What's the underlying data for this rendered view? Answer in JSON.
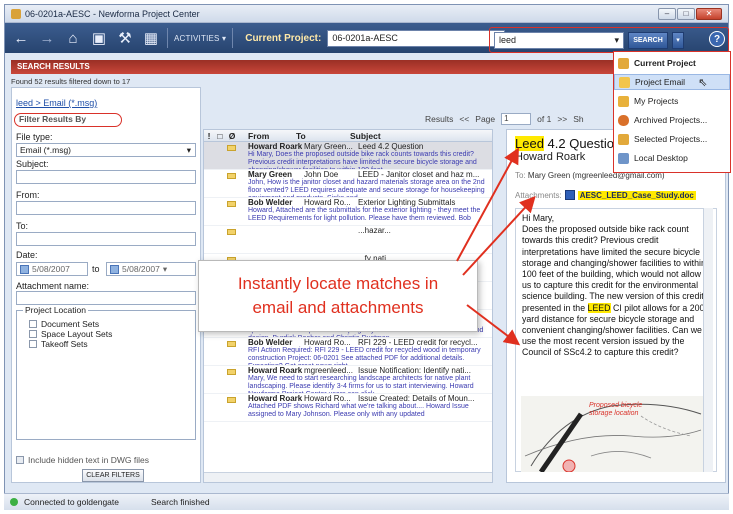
{
  "window": {
    "title": "06-0201a-AESC - Newforma Project Center"
  },
  "toolbar": {
    "activities_label": "ACTIVITIES",
    "current_project_label": "Current Project:",
    "current_project_value": "06-0201a-AESC",
    "search_value": "leed",
    "search_button": "SEARCH"
  },
  "search_scope_menu": {
    "items": [
      {
        "label": "Current Project",
        "icon": "project-icon"
      },
      {
        "label": "Project Email",
        "icon": "email-icon"
      },
      {
        "label": "My Projects",
        "icon": "my-projects-icon"
      },
      {
        "label": "Archived Projects...",
        "icon": "archive-icon"
      },
      {
        "label": "Selected Projects...",
        "icon": "selected-projects-icon"
      },
      {
        "label": "Local Desktop",
        "icon": "desktop-icon"
      }
    ]
  },
  "results": {
    "header": "SEARCH RESULTS",
    "found_text": "Found 52 results filtered down to 17",
    "breadcrumb": "leed > Email (*.msg)",
    "filter_heading": "Filter Results By",
    "pager": {
      "results_label": "Results",
      "prev": "<<",
      "page_label": "Page",
      "page_value": "1",
      "of_label": "of 1",
      "next": ">>",
      "show_label": "Sh"
    }
  },
  "filters": {
    "file_type_label": "File type:",
    "file_type_value": "Email (*.msg)",
    "subject_label": "Subject:",
    "from_label": "From:",
    "to_label": "To:",
    "date_label": "Date:",
    "date_from": "5/08/2007",
    "date_to_label": "to",
    "date_to": "5/08/2007",
    "attachment_label": "Attachment name:",
    "project_location_label": "Project Location",
    "locations": [
      "Document Sets",
      "Space Layout Sets",
      "Takeoff Sets"
    ],
    "include_hidden_label": "Include hidden text in DWG files",
    "clear_button": "CLEAR FILTERS"
  },
  "list": {
    "columns": [
      "!",
      "□",
      "Ø",
      "From",
      "To",
      "Subject"
    ],
    "rows": [
      {
        "from": "Howard Roark",
        "to": "Mary Green...",
        "subject": "Leed 4.2 Question",
        "preview": "Hi Mary,  Does the proposed outside bike rack counts towards this credit? Previous credit interpretations have limited the secure bicycle storage and changing/shower facilities to within 100 feet",
        "selected": true
      },
      {
        "from": "Mary Green",
        "to": "John Doe",
        "subject": "LEED - Janitor closet and haz m...",
        "preview": "John,  How is the janitor closet and hazard materials storage area on the 2nd floor vented? LEED requires adequate and secure storage for housekeeping equipment and products.  Sinks and",
        "selected": false
      },
      {
        "from": "Bob Welder",
        "to": "Howard Ro...",
        "subject": "Exterior Lighting Submittals",
        "preview": "Howard,  Attached are the submittals for the exterior lighting - they meet the LEED Requirements for light pollution.  Please have them reviewed.  Bob",
        "selected": false
      },
      {
        "from": "",
        "to": "",
        "subject": "...hazar...",
        "preview": "",
        "selected": false
      },
      {
        "from": "",
        "to": "",
        "subject": "...fy nati...",
        "preview": "",
        "selected": false
      },
      {
        "from": "",
        "to": "",
        "subject": "",
        "preview": "",
        "selected": false
      },
      {
        "from": "Mary Green",
        "to": "Howard Ro...",
        "subject": "Re: Issue Notification: Identify ...",
        "preview": "Hello Howard,  There are many landscape designers in your area that specialize in native plan landscaping. My recommendations are Mindlewood design, Burdick Booher and Christie Dustman",
        "selected": false
      },
      {
        "from": "Bob Welder",
        "to": "Howard Ro...",
        "subject": "RFI 229 - LEED credit for recycl...",
        "preview": "RFI Action Required: RFI 229 - LEED credit for recycled wood in temporary construction Project: 06-0201 See attached PDF for additional details.        Expecting? Get great news right",
        "selected": false
      },
      {
        "from": "Howard Roark",
        "to": "mgreenleed...",
        "subject": "Issue Notification: Identify nati...",
        "preview": "Mary,  We need to start researching landscape architects for native plant landscaping.  Please identify 3-4 firms for us to start interviewing.  Howard  Newforma Project Center users can click",
        "selected": false
      },
      {
        "from": "Howard Roark",
        "to": "Howard Ro...",
        "subject": "Issue Created: Details of Moun...",
        "preview": "Attached PDF shows Richard what we're talking about....  Howard  Issue assigned to Mary Johnson. Please only with any updated",
        "selected": false
      }
    ]
  },
  "preview": {
    "title_hl": "Leed",
    "title_rest": " 4.2 Question",
    "sender": "Howard Roark",
    "to_label": "To:",
    "to_value": "Mary Green (mgreenleed@gmail.com)",
    "attachments_label": "Attachments:",
    "attachment_file": "AESC_LEED_Case_Study.doc",
    "body_1": "Hi Mary,",
    "body_2": "Does the proposed outside bike rack count towards this credit? Previous credit interpretations have limited the secure bicycle storage and changing/shower facilities to within 100 feet of the building, which would not allow us to capture this credit for the environmental science building. The new version of this credit presented in the",
    "body_hl": "LEED",
    "body_3": " CI pilot allows for a 200 yard distance for secure bicycle storage and convenient changing/shower facilities. Can we use the most recent version issued by the Council of SSc4.2 to capture this credit?",
    "image_label": "Proposed bicycle storage location"
  },
  "callout": {
    "text": "Instantly locate matches in email and attachments",
    "color": "#e0301f"
  },
  "status": {
    "connection": "Connected to goldengate",
    "search_state": "Search finished"
  },
  "colors": {
    "accent": "#d9322a",
    "toolbar": "#27446f",
    "highlight": "#ffe900"
  }
}
